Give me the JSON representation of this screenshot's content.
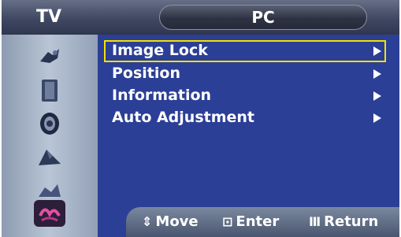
{
  "header": {
    "tv_label": "TV",
    "pc_label": "PC"
  },
  "sidebar": {
    "icons": [
      "picture-icon",
      "sound-icon",
      "channel-icon",
      "setup-icon",
      "input-icon",
      "function-icon"
    ]
  },
  "menu": {
    "items": [
      {
        "label": "Image Lock",
        "selected": true
      },
      {
        "label": "Position",
        "selected": false
      },
      {
        "label": "Information",
        "selected": false
      },
      {
        "label": "Auto Adjustment",
        "selected": false
      }
    ]
  },
  "footer": {
    "move_glyph": "⇕",
    "move_label": "Move",
    "enter_glyph": "⊡",
    "enter_label": "Enter",
    "return_glyph": "Ⅲ",
    "return_label": "Return"
  },
  "colors": {
    "panel": "#2c3f96",
    "highlight": "#f5e100",
    "sidebar": "#b9c5d6"
  }
}
